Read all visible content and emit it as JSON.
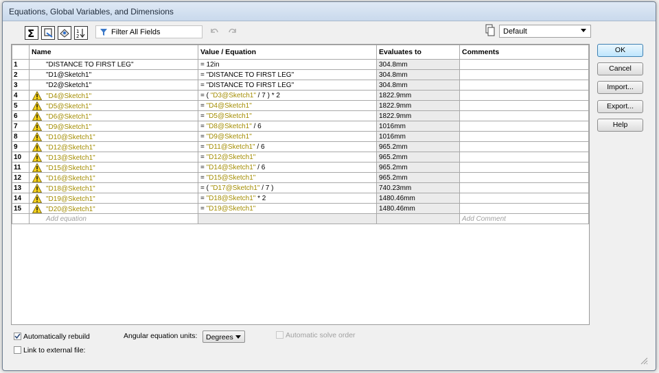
{
  "window": {
    "title": "Equations, Global Variables, and Dimensions"
  },
  "toolbar": {
    "filter_label": "Filter All Fields",
    "config_selected": "Default",
    "buttons": [
      "equation-view-icon",
      "sketch-equation-view-icon",
      "dimension-view-icon",
      "ordered-view-icon"
    ]
  },
  "table": {
    "headers": [
      "Name",
      "Value / Equation",
      "Evaluates to",
      "Comments"
    ],
    "rows": [
      {
        "num": "1",
        "warn": false,
        "name": "\"DISTANCE TO FIRST LEG\"",
        "eq_prefix": "= 12in",
        "eq_ref": "",
        "eq_suffix": "",
        "evaluates": "304.8mm"
      },
      {
        "num": "2",
        "warn": false,
        "name": "\"D1@Sketch1\"",
        "eq_prefix": "= \"DISTANCE TO FIRST LEG\"",
        "eq_ref": "",
        "eq_suffix": "",
        "evaluates": "304.8mm"
      },
      {
        "num": "3",
        "warn": false,
        "name": "\"D2@Sketch1\"",
        "eq_prefix": "= \"DISTANCE TO FIRST LEG\"",
        "eq_ref": "",
        "eq_suffix": "",
        "evaluates": "304.8mm"
      },
      {
        "num": "4",
        "warn": true,
        "name": "\"D4@Sketch1\"",
        "eq_prefix": "= ( ",
        "eq_ref": "\"D3@Sketch1\"",
        "eq_suffix": " / 7 ) * 2",
        "evaluates": "1822.9mm"
      },
      {
        "num": "5",
        "warn": true,
        "name": "\"D5@Sketch1\"",
        "eq_prefix": "= ",
        "eq_ref": "\"D4@Sketch1\"",
        "eq_suffix": "",
        "evaluates": "1822.9mm"
      },
      {
        "num": "6",
        "warn": true,
        "name": "\"D6@Sketch1\"",
        "eq_prefix": "= ",
        "eq_ref": "\"D5@Sketch1\"",
        "eq_suffix": "",
        "evaluates": "1822.9mm"
      },
      {
        "num": "7",
        "warn": true,
        "name": "\"D9@Sketch1\"",
        "eq_prefix": "= ",
        "eq_ref": "\"D8@Sketch1\"",
        "eq_suffix": " / 6",
        "evaluates": "1016mm"
      },
      {
        "num": "8",
        "warn": true,
        "name": "\"D10@Sketch1\"",
        "eq_prefix": "= ",
        "eq_ref": "\"D9@Sketch1\"",
        "eq_suffix": "",
        "evaluates": "1016mm"
      },
      {
        "num": "9",
        "warn": true,
        "name": "\"D12@Sketch1\"",
        "eq_prefix": "= ",
        "eq_ref": "\"D11@Sketch1\"",
        "eq_suffix": " / 6",
        "evaluates": "965.2mm"
      },
      {
        "num": "10",
        "warn": true,
        "name": "\"D13@Sketch1\"",
        "eq_prefix": "= ",
        "eq_ref": "\"D12@Sketch1\"",
        "eq_suffix": "",
        "evaluates": "965.2mm"
      },
      {
        "num": "11",
        "warn": true,
        "name": "\"D15@Sketch1\"",
        "eq_prefix": "= ",
        "eq_ref": "\"D14@Sketch1\"",
        "eq_suffix": " / 6",
        "evaluates": "965.2mm"
      },
      {
        "num": "12",
        "warn": true,
        "name": "\"D16@Sketch1\"",
        "eq_prefix": "= ",
        "eq_ref": "\"D15@Sketch1\"",
        "eq_suffix": "",
        "evaluates": "965.2mm"
      },
      {
        "num": "13",
        "warn": true,
        "name": "\"D18@Sketch1\"",
        "eq_prefix": "= ( ",
        "eq_ref": "\"D17@Sketch1\"",
        "eq_suffix": " / 7 )",
        "evaluates": "740.23mm"
      },
      {
        "num": "14",
        "warn": true,
        "name": "\"D19@Sketch1\"",
        "eq_prefix": "= ",
        "eq_ref": "\"D18@Sketch1\"",
        "eq_suffix": " * 2",
        "evaluates": "1480.46mm"
      },
      {
        "num": "15",
        "warn": true,
        "name": "\"D20@Sketch1\"",
        "eq_prefix": "= ",
        "eq_ref": "\"D19@Sketch1\"",
        "eq_suffix": "",
        "evaluates": "1480.46mm"
      }
    ],
    "add_equation_placeholder": "Add equation",
    "add_comment_placeholder": "Add Comment"
  },
  "side_buttons": {
    "ok": "OK",
    "cancel": "Cancel",
    "import": "Import...",
    "export": "Export...",
    "help": "Help"
  },
  "bottom": {
    "auto_rebuild_label": "Automatically rebuild",
    "auto_rebuild_checked": true,
    "angular_units_label": "Angular equation units:",
    "angular_units_value": "Degrees",
    "auto_solve_label": "Automatic solve order",
    "link_external_label": "Link to external file:"
  },
  "colors": {
    "warning_text": "#a38c00",
    "title_bar": "#c9d9ec"
  }
}
